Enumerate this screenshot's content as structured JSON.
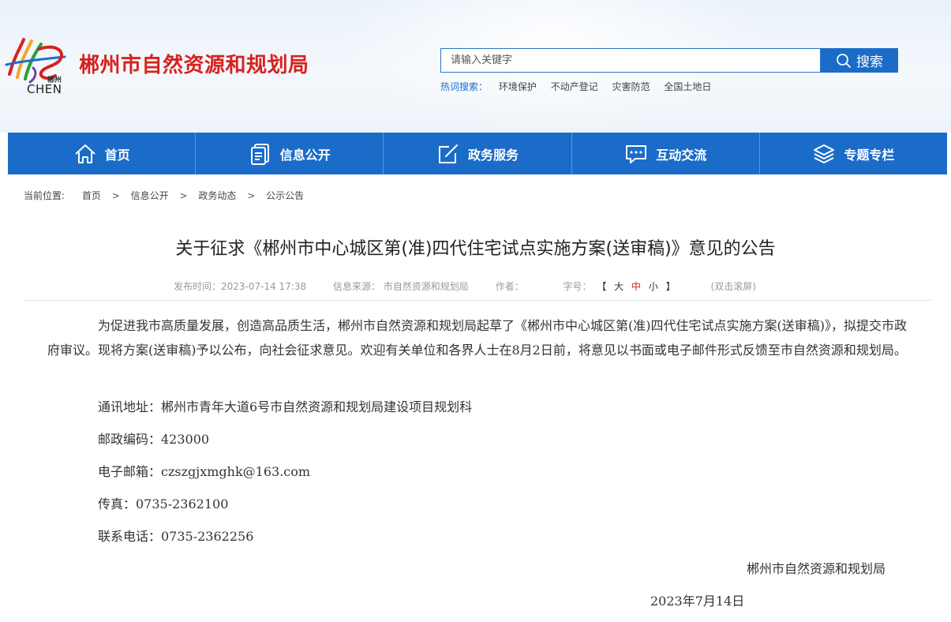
{
  "site": {
    "logo_text": "郴州",
    "logo_sub": "CHEN",
    "title": "郴州市自然资源和规划局"
  },
  "search": {
    "placeholder": "请输入关键字",
    "button": "搜索",
    "hot_label": "热词搜索：",
    "hot_words": [
      "环境保护",
      "不动产登记",
      "灾害防范",
      "全国土地日"
    ]
  },
  "nav": [
    {
      "label": "首页",
      "icon": "home-icon"
    },
    {
      "label": "信息公开",
      "icon": "document-icon"
    },
    {
      "label": "政务服务",
      "icon": "edit-icon"
    },
    {
      "label": "互动交流",
      "icon": "chat-icon"
    },
    {
      "label": "专题专栏",
      "icon": "layers-icon"
    }
  ],
  "breadcrumb": {
    "label": "当前位置:",
    "items": [
      "首页",
      "信息公开",
      "政务动态",
      "公示公告"
    ]
  },
  "article": {
    "title": "关于征求《郴州市中心城区第(准)四代住宅试点实施方案(送审稿)》意见的公告",
    "meta": {
      "publish_time": "发布时间：2023-07-14 17:38",
      "source": "信息来源：  市自然资源和规划局",
      "author": "作者：",
      "font_size_label": "字号：",
      "fs_open": "【",
      "fs_large": "大",
      "fs_medium": "中",
      "fs_small": "小",
      "fs_close": "】",
      "dblclick": "(双击滚屏)"
    },
    "paragraph": "为促进我市高质量发展，创造高品质生活，郴州市自然资源和规划局起草了《郴州市中心城区第(准)四代住宅试点实施方案(送审稿)》，拟提交市政府审议。现将方案(送审稿)予以公布，向社会征求意见。欢迎有关单位和各界人士在8月2日前，将意见以书面或电子邮件形式反馈至市自然资源和规划局。",
    "address": "通讯地址：郴州市青年大道6号市自然资源和规划局建设项目规划科",
    "postcode": "邮政编码：423000",
    "email": "电子邮箱：czszgjxmghk@163.com",
    "fax": "传真：0735-2362100",
    "phone": "联系电话：0735-2362256",
    "signature": "郴州市自然资源和规划局",
    "date": "2023年7月14日"
  }
}
